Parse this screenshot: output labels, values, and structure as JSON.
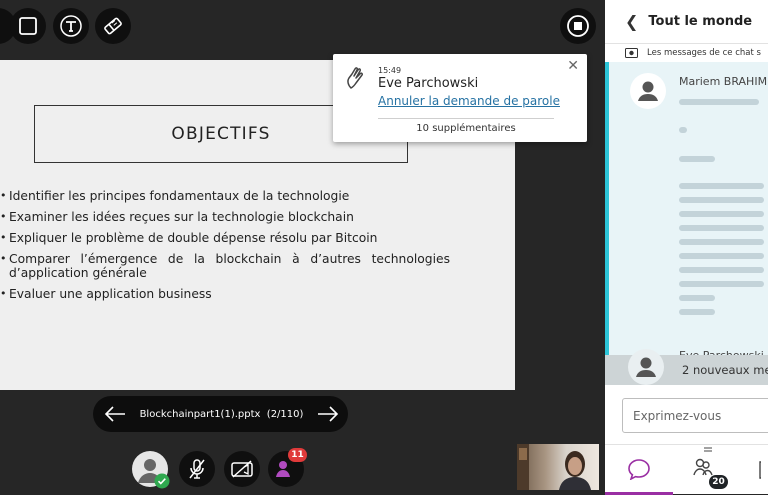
{
  "slide": {
    "heading": "OBJECTIFS",
    "bullets": [
      "Identifier les principes fondamentaux de la technologie",
      "Examiner les idées reçues sur la technologie blockchain",
      "Expliquer le problème de double dépense résolu par Bitcoin",
      "Comparer l’émergence de la blockchain à d’autres technologies d’application générale",
      "Evaluer une application business"
    ]
  },
  "notification": {
    "time": "15:49",
    "name": "Eve Parchowski",
    "action_link": "Annuler la demande de parole",
    "more": "10 supplémentaires",
    "close_glyph": "✕"
  },
  "slide_nav": {
    "file_label": "Blockchainpart1(1).pptx",
    "page_label": "(2/110)"
  },
  "participants_badge": "11",
  "chat": {
    "title": "Tout le monde",
    "recording_notice": "Les messages de ce chat s",
    "messages": [
      {
        "sender": "Mariem BRAHIM"
      },
      {
        "sender": "Eve Parchowski"
      }
    ],
    "new_messages": "2 nouveaux me",
    "input_placeholder": "Exprimez-vous",
    "attendees_count": "20"
  },
  "colors": {
    "accent_cyan": "#2cc5d8",
    "link_blue": "#2672a3",
    "chat_tab_purple": "#9a2fa3",
    "badge_red": "#e03a3a",
    "status_green": "#2fa84f"
  },
  "icons": [
    "shape-icon",
    "square-icon",
    "text-icon",
    "eraser-icon",
    "stop-share-icon",
    "raise-hand-icon",
    "close-icon",
    "arrow-left-icon",
    "arrow-right-icon",
    "avatar-icon",
    "mic-off-icon",
    "camera-off-icon",
    "participants-icon",
    "chevron-left-icon",
    "record-icon",
    "chat-bubble-icon",
    "attendees-icon",
    "menu-icon"
  ]
}
